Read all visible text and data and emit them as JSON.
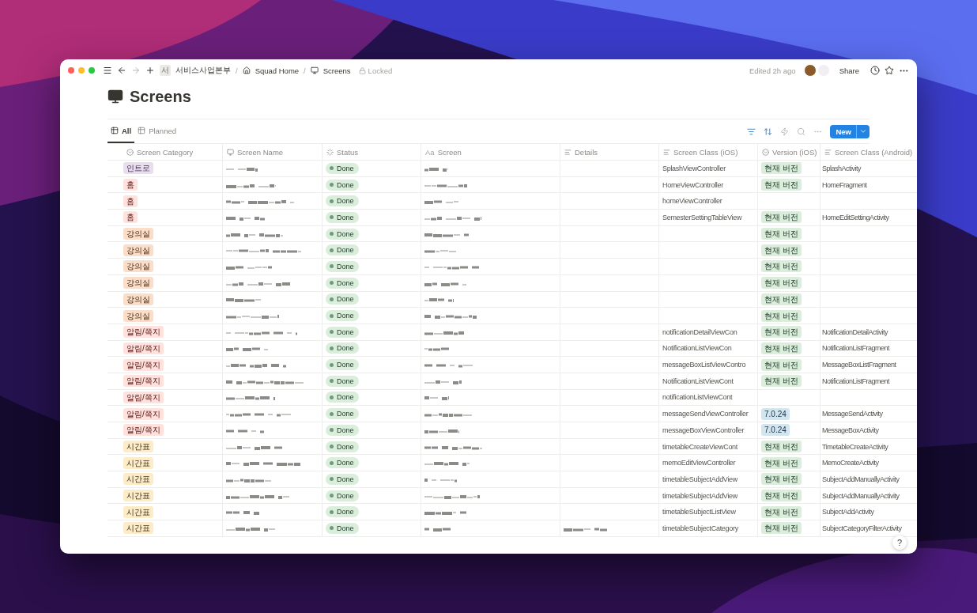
{
  "topbar": {
    "workspace_initial": "서",
    "breadcrumbs": [
      {
        "label": "서비스사업본부",
        "separator": "/",
        "kind": "workspace"
      },
      {
        "label": "Squad Home",
        "separator": "/",
        "kind": "page"
      },
      {
        "label": "Screens",
        "kind": "database"
      }
    ],
    "locked_label": "Locked",
    "edited": "Edited 2h ago",
    "share": "Share"
  },
  "page": {
    "title": "Screens"
  },
  "views": [
    {
      "label": "All",
      "selected": true
    },
    {
      "label": "Planned",
      "selected": false
    }
  ],
  "new_button": "New",
  "columns": [
    {
      "label": "Screen Category",
      "kind": "select"
    },
    {
      "label": "Screen Name",
      "kind": "title"
    },
    {
      "label": "Status",
      "kind": "status"
    },
    {
      "label": "Screen",
      "kind": "text_aa",
      "icon_text": "Aa"
    },
    {
      "label": "Details",
      "kind": "text"
    },
    {
      "label": "Screen Class (iOS)",
      "kind": "text"
    },
    {
      "label": "Version (iOS)",
      "kind": "select"
    },
    {
      "label": "Screen Class (Android)",
      "kind": "text"
    }
  ],
  "rows": [
    {
      "category": {
        "label": "인트로",
        "color": "#e8deee"
      },
      "redacted": true,
      "status": "Done",
      "ios_class": "SplashViewController",
      "version": {
        "label": "현재 버전",
        "color": "#dbeddb"
      },
      "android_class": "SplashActivity"
    },
    {
      "category": {
        "label": "홈",
        "color": "#ffe2dd"
      },
      "redacted": true,
      "status": "Done",
      "ios_class": "HomeViewController",
      "version": {
        "label": "현재 버전",
        "color": "#dbeddb"
      },
      "android_class": "HomeFragment"
    },
    {
      "category": {
        "label": "홈",
        "color": "#ffe2dd"
      },
      "redacted": true,
      "status": "Done",
      "ios_class": "homeViewController"
    },
    {
      "category": {
        "label": "홈",
        "color": "#ffe2dd"
      },
      "redacted": true,
      "status": "Done",
      "ios_class": "SemesterSettingTableView",
      "version": {
        "label": "현재 버전",
        "color": "#dbeddb"
      },
      "android_class": "HomeEditSettingActivity"
    },
    {
      "category": {
        "label": "강의실",
        "color": "#fadec9"
      },
      "redacted": true,
      "status": "Done",
      "version": {
        "label": "현재 버전",
        "color": "#dbeddb"
      }
    },
    {
      "category": {
        "label": "강의실",
        "color": "#fadec9"
      },
      "redacted": true,
      "status": "Done",
      "version": {
        "label": "현재 버전",
        "color": "#dbeddb"
      }
    },
    {
      "category": {
        "label": "강의실",
        "color": "#fadec9"
      },
      "redacted": true,
      "status": "Done",
      "version": {
        "label": "현재 버전",
        "color": "#dbeddb"
      }
    },
    {
      "category": {
        "label": "강의실",
        "color": "#fadec9"
      },
      "redacted": true,
      "status": "Done",
      "version": {
        "label": "현재 버전",
        "color": "#dbeddb"
      }
    },
    {
      "category": {
        "label": "강의실",
        "color": "#fadec9"
      },
      "redacted": true,
      "status": "Done",
      "version": {
        "label": "현재 버전",
        "color": "#dbeddb"
      }
    },
    {
      "category": {
        "label": "강의실",
        "color": "#fadec9"
      },
      "redacted": true,
      "status": "Done",
      "version": {
        "label": "현재 버전",
        "color": "#dbeddb"
      }
    },
    {
      "category": {
        "label": "알림/쪽지",
        "color": "#ffe2dd"
      },
      "redacted": true,
      "status": "Done",
      "ios_class": "notificationDetailViewCon",
      "version": {
        "label": "현재 버전",
        "color": "#dbeddb"
      },
      "android_class": "NotificationDetailActivity"
    },
    {
      "category": {
        "label": "알림/쪽지",
        "color": "#ffe2dd"
      },
      "redacted": true,
      "status": "Done",
      "ios_class": "NotificationListViewCon",
      "version": {
        "label": "현재 버전",
        "color": "#dbeddb"
      },
      "android_class": "NotificationListFragment"
    },
    {
      "category": {
        "label": "알림/쪽지",
        "color": "#ffe2dd"
      },
      "redacted": true,
      "status": "Done",
      "ios_class": "messageBoxListViewContro",
      "version": {
        "label": "현재 버전",
        "color": "#dbeddb"
      },
      "android_class": "MessageBoxListFragment"
    },
    {
      "category": {
        "label": "알림/쪽지",
        "color": "#ffe2dd"
      },
      "redacted": true,
      "status": "Done",
      "ios_class": "NotificationListViewCont",
      "version": {
        "label": "현재 버전",
        "color": "#dbeddb"
      },
      "android_class": "NotificationListFragment"
    },
    {
      "category": {
        "label": "알림/쪽지",
        "color": "#ffe2dd"
      },
      "redacted": true,
      "status": "Done",
      "ios_class": "notificationListViewCont"
    },
    {
      "category": {
        "label": "알림/쪽지",
        "color": "#ffe2dd"
      },
      "redacted": true,
      "status": "Done",
      "ios_class": "messageSendViewController",
      "version": {
        "label": "7.0.24",
        "color": "#d3e5ef"
      },
      "android_class": "MessageSendActivity"
    },
    {
      "category": {
        "label": "알림/쪽지",
        "color": "#ffe2dd"
      },
      "redacted": true,
      "status": "Done",
      "ios_class": "messageBoxViewController",
      "version": {
        "label": "7.0.24",
        "color": "#d3e5ef"
      },
      "android_class": "MessageBoxActivity"
    },
    {
      "category": {
        "label": "시간표",
        "color": "#fdecc8"
      },
      "redacted": true,
      "status": "Done",
      "ios_class": "timetableCreateViewCont",
      "version": {
        "label": "현재 버전",
        "color": "#dbeddb"
      },
      "android_class": "TimetableCreateActivity"
    },
    {
      "category": {
        "label": "시간표",
        "color": "#fdecc8"
      },
      "redacted": true,
      "status": "Done",
      "ios_class": "memoEditViewController",
      "version": {
        "label": "현재 버전",
        "color": "#dbeddb"
      },
      "android_class": "MemoCreateActivity"
    },
    {
      "category": {
        "label": "시간표",
        "color": "#fdecc8"
      },
      "redacted": true,
      "status": "Done",
      "ios_class": "timetableSubjectAddView",
      "version": {
        "label": "현재 버전",
        "color": "#dbeddb"
      },
      "android_class": "SubjectAddManuallyActivity"
    },
    {
      "category": {
        "label": "시간표",
        "color": "#fdecc8"
      },
      "redacted": true,
      "status": "Done",
      "ios_class": "timetableSubjectAddView",
      "version": {
        "label": "현재 버전",
        "color": "#dbeddb"
      },
      "android_class": "SubjectAddManuallyActivity"
    },
    {
      "category": {
        "label": "시간표",
        "color": "#fdecc8"
      },
      "redacted": true,
      "status": "Done",
      "ios_class": "timetableSubjectListView",
      "version": {
        "label": "현재 버전",
        "color": "#dbeddb"
      },
      "android_class": "SubjectAddActivity"
    },
    {
      "category": {
        "label": "시간표",
        "color": "#fdecc8"
      },
      "redacted": true,
      "details_redacted": true,
      "status": "Done",
      "ios_class": "timetableSubjectCategory",
      "version": {
        "label": "현재 버전",
        "color": "#dbeddb"
      },
      "android_class": "SubjectCategoryFilterActivity"
    }
  ],
  "help_button": "?"
}
